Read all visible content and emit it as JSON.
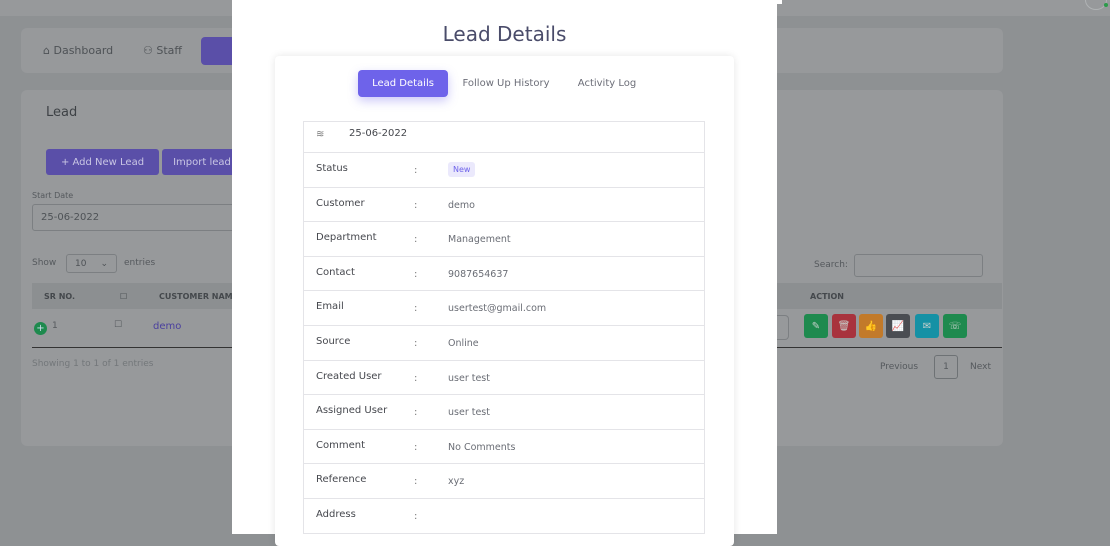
{
  "background": {
    "nav": [
      {
        "label": "Dashboard",
        "icon": "home-icon"
      },
      {
        "label": "Staff",
        "icon": "users-icon"
      }
    ],
    "lead_title": "Lead",
    "add_button": "+ Add New Lead",
    "import_button": "Import lead",
    "start_date_label": "Start Date",
    "start_date_value": "25-06-2022",
    "show_label": "Show",
    "entries_value": "10",
    "entries_label": "entries",
    "search_label": "Search:",
    "columns": [
      "SR NO.",
      "CUSTOMER NAME",
      "ACTION"
    ],
    "row": {
      "sr": "1",
      "customer": "demo"
    },
    "info": "Showing 1 to 1 of 1 entries",
    "pagination": {
      "previous": "Previous",
      "page": "1",
      "next": "Next"
    },
    "action_colors": [
      "#1e8a4e",
      "#a8333d",
      "#c27a2a",
      "#4a4d52",
      "#1591a5",
      "#1e8a4e"
    ]
  },
  "modal": {
    "title": "Lead Details",
    "tabs": [
      {
        "label": "Lead Details",
        "active": true
      },
      {
        "label": "Follow Up History"
      },
      {
        "label": "Activity Log"
      }
    ],
    "date": "25-06-2022",
    "status_label": "Status",
    "status_value": "New",
    "fields": [
      {
        "label": "Customer",
        "value": "demo"
      },
      {
        "label": "Department",
        "value": "Management"
      },
      {
        "label": "Contact",
        "value": "9087654637"
      },
      {
        "label": "Email",
        "value": "usertest@gmail.com"
      },
      {
        "label": "Source",
        "value": "Online"
      },
      {
        "label": "Created User",
        "value": "user test"
      },
      {
        "label": "Assigned User",
        "value": "user test"
      },
      {
        "label": "Comment",
        "value": "No Comments"
      },
      {
        "label": "Reference",
        "value": "xyz"
      },
      {
        "label": "Address",
        "value": ""
      }
    ],
    "colon": ":"
  }
}
